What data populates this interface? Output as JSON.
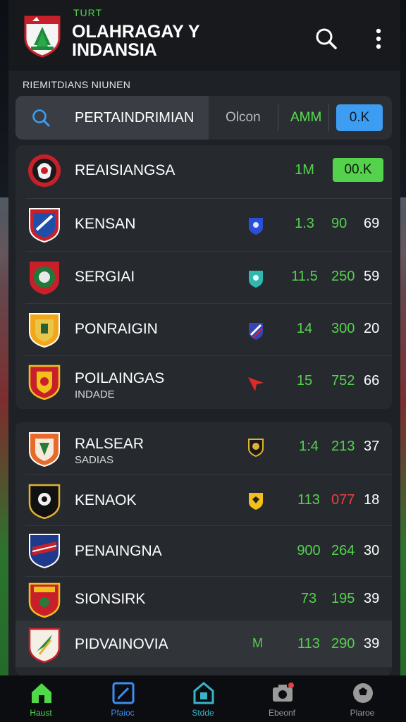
{
  "header": {
    "tag": "TURT",
    "title_line1": "OLAHRAGAY Y",
    "title_line2": "INDANSIA"
  },
  "section_label": "RIEMITDIANS NIUNEN",
  "filter_bar": {
    "search_text": "PERTAINDRIMIAN",
    "option_1": "Olcon",
    "option_2": "AMM",
    "active_pill": "0.K"
  },
  "group_1": [
    {
      "name": "REAISIANGSA",
      "sub": "",
      "v1": "1M",
      "v2": "",
      "v3": "",
      "pill": "00.K",
      "badge": "",
      "crest": "red-black"
    },
    {
      "name": "KENSAN",
      "sub": "",
      "v1": "1.3",
      "v2": "90",
      "v3": "69",
      "pill": "",
      "badge": "blue-shield",
      "crest": "red-blue"
    },
    {
      "name": "SERGIAI",
      "sub": "",
      "v1": "11.5",
      "v2": "250",
      "v3": "59",
      "pill": "",
      "badge": "teal-shield",
      "crest": "red-green"
    },
    {
      "name": "PONRAIGIN",
      "sub": "",
      "v1": "14",
      "v2": "300",
      "v3": "20",
      "pill": "",
      "badge": "striped-shield",
      "crest": "yellow-orange"
    },
    {
      "name": "POILAINGAS",
      "sub": "INDADE",
      "v1": "15",
      "v2": "752",
      "v3": "66",
      "pill": "",
      "badge": "red-arrow",
      "crest": "red-yellow"
    }
  ],
  "group_2": [
    {
      "name": "RALSEAR",
      "sub": "SADIAS",
      "v1": "1:4",
      "v2": "213",
      "v3": "37",
      "badge": "gold-shield",
      "crest": "orange-white",
      "v2_red": false,
      "highlight": false
    },
    {
      "name": "KENAOK",
      "sub": "",
      "v1": "113",
      "v2": "077",
      "v3": "18",
      "badge": "yellow-shield",
      "crest": "black-gold",
      "v2_red": true,
      "highlight": false
    },
    {
      "name": "PENAINGNA",
      "sub": "",
      "v1": "900",
      "v2": "264",
      "v3": "30",
      "badge": "",
      "crest": "navy-red",
      "v2_red": false,
      "highlight": false
    },
    {
      "name": "SIONSIRK",
      "sub": "",
      "v1": "73",
      "v2": "195",
      "v3": "39",
      "badge": "",
      "crest": "red-gold",
      "v2_red": false,
      "highlight": false
    },
    {
      "name": "PIDVAINOVIA",
      "sub": "",
      "v1": "113",
      "v2": "290",
      "v3": "39",
      "badge": "M",
      "crest": "white-green",
      "v2_red": false,
      "highlight": true
    }
  ],
  "nav": [
    {
      "label": "Haust",
      "icon": "home-icon",
      "color": "#4fd94a"
    },
    {
      "label": "Pfaioc",
      "icon": "edit-icon",
      "color": "#3d8ef2"
    },
    {
      "label": "Stdde",
      "icon": "stadium-icon",
      "color": "#39b5c7"
    },
    {
      "label": "Ebeonf",
      "icon": "camera-icon",
      "color": "#9a9a9a"
    },
    {
      "label": "Plaroe",
      "icon": "ball-icon",
      "color": "#9a9a9a"
    }
  ],
  "colors": {
    "accent_green": "#54d24c",
    "accent_blue": "#3d9df2",
    "danger_red": "#e84141"
  }
}
